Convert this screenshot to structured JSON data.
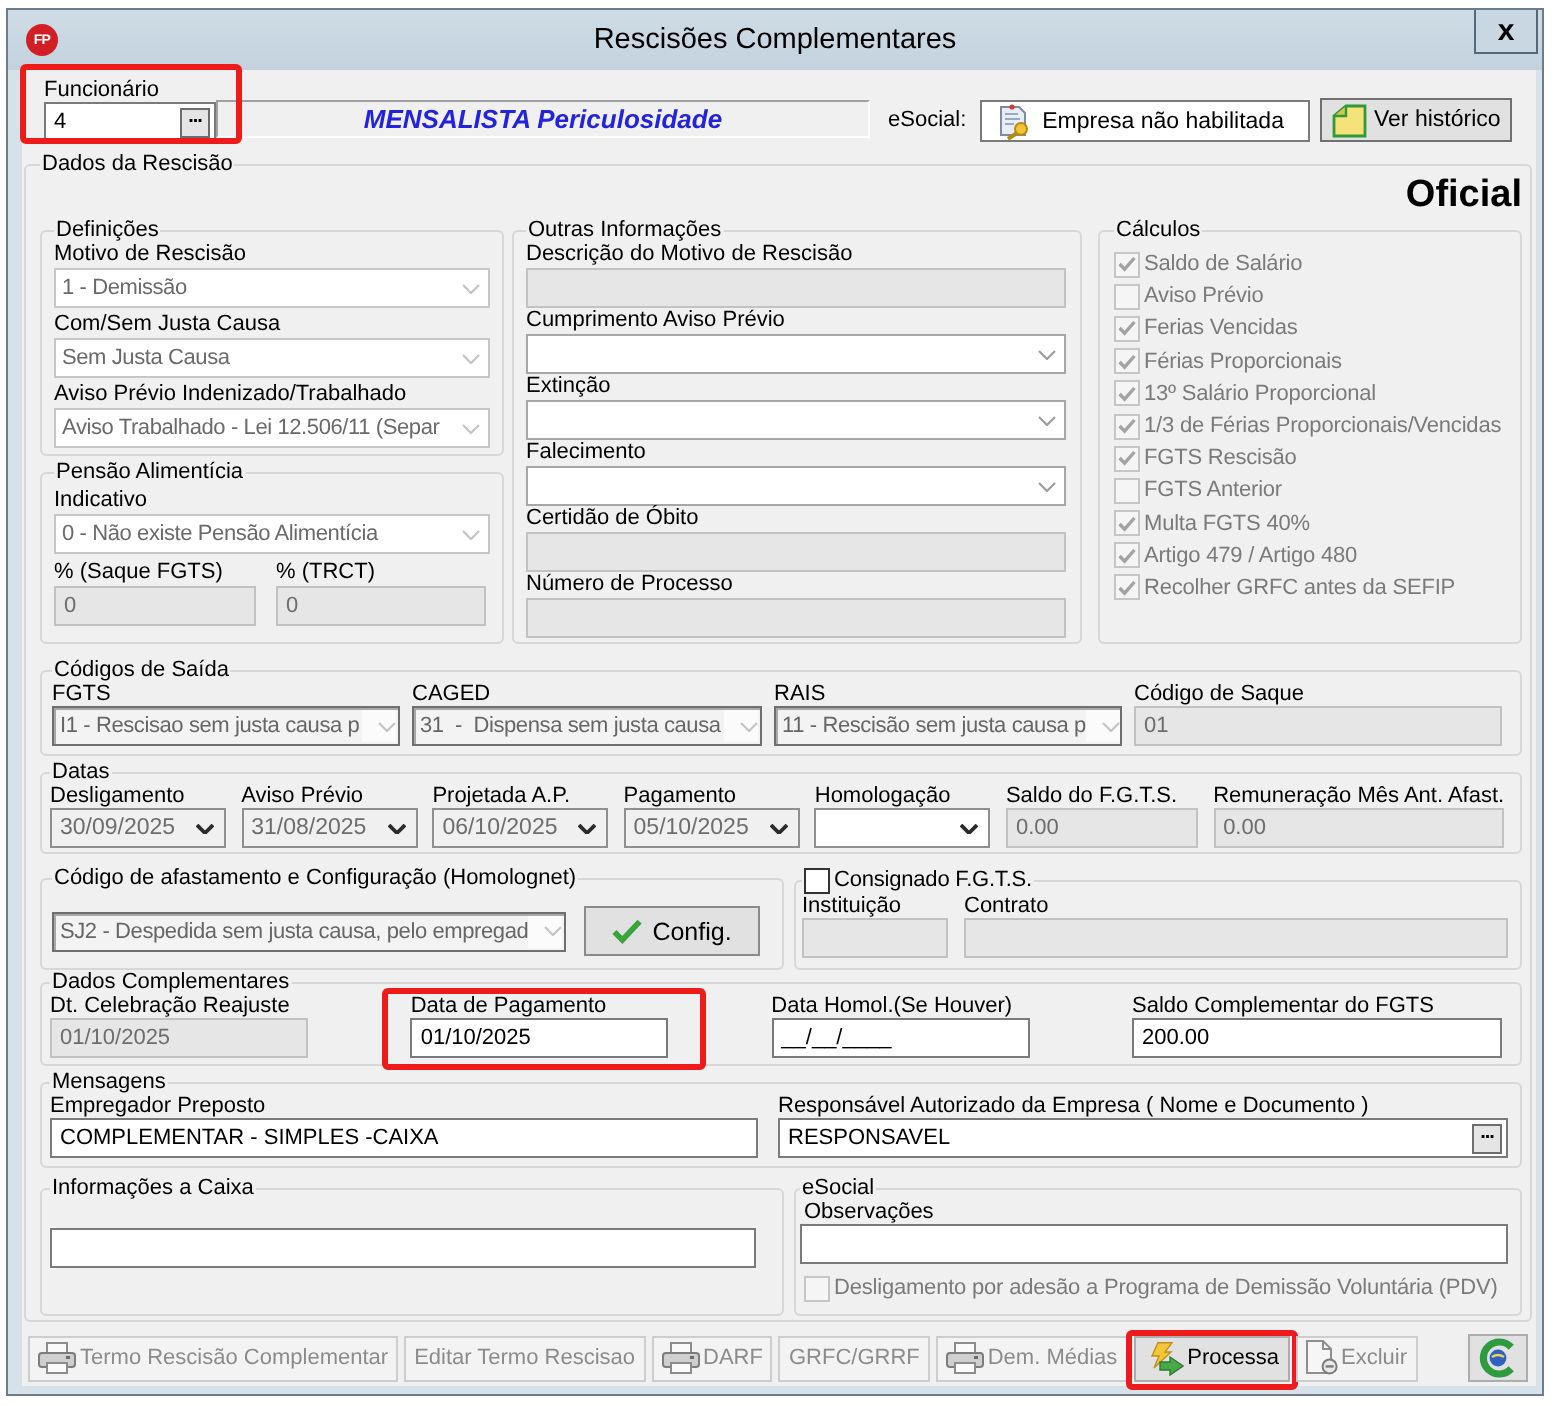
{
  "window": {
    "logo_text": "FP",
    "title": "Rescisões Complementares",
    "close_label": "x"
  },
  "header": {
    "employee": {
      "label": "Funcionário",
      "value": "4",
      "lookup_label": "...",
      "highlighted": true
    },
    "category": "MENSALISTA Periculosidade",
    "esocial_label": "eSocial:",
    "esocial_status": "Empresa não habilitada",
    "history_button": "Ver histórico"
  },
  "termination": {
    "title": "Dados da Rescisão",
    "mode": "Oficial",
    "definitions": {
      "title": "Definições",
      "fields": [
        {
          "kind": "combo",
          "label": "Motivo de Rescisão",
          "value": "1 - Demissão",
          "disabled": true
        },
        {
          "kind": "combo",
          "label": "Com/Sem Justa Causa",
          "value": "Sem Justa Causa",
          "disabled": true
        },
        {
          "kind": "combo",
          "label": "Aviso Prévio Indenizado/Trabalhado",
          "value": "Aviso Trabalhado - Lei 12.506/11 (Separ",
          "disabled": true
        }
      ]
    },
    "alimony": {
      "title": "Pensão Alimentícia",
      "indicator": {
        "kind": "combo",
        "label": "Indicativo",
        "value": "0 - Não existe Pensão Alimentícia",
        "disabled": true
      },
      "percentages": [
        {
          "kind": "input",
          "label": "% (Saque FGTS)",
          "value": "0",
          "disabled": true
        },
        {
          "kind": "input",
          "label": "% (TRCT)",
          "value": "0",
          "disabled": true
        }
      ]
    },
    "other_info": {
      "title": "Outras Informações",
      "fields": [
        {
          "kind": "input",
          "label": "Descrição do Motivo de Rescisão",
          "disabled": true
        },
        {
          "kind": "combo",
          "label": "Cumprimento Aviso Prévio",
          "disabled": false
        },
        {
          "kind": "combo",
          "label": "Extinção",
          "disabled": false
        },
        {
          "kind": "combo",
          "label": "Falecimento",
          "disabled": false
        },
        {
          "kind": "input",
          "label": "Certidão de Óbito",
          "disabled": true
        },
        {
          "kind": "input",
          "label": "Número de Processo",
          "disabled": true
        }
      ]
    },
    "calculations": {
      "title": "Cálculos",
      "items": [
        {
          "label": "Saldo de Salário",
          "checked": true,
          "disabled": true
        },
        {
          "label": "Aviso Prévio",
          "checked": false,
          "disabled": true
        },
        {
          "label": "Ferias Vencidas",
          "checked": true,
          "disabled": true
        },
        {
          "label": "Férias Proporcionais",
          "checked": true,
          "disabled": true
        },
        {
          "label": "13º Salário Proporcional",
          "checked": true,
          "disabled": true
        },
        {
          "label": "1/3 de Férias Proporcionais/Vencidas",
          "checked": true,
          "disabled": true
        },
        {
          "label": "FGTS Rescisão",
          "checked": true,
          "disabled": true
        },
        {
          "label": "FGTS Anterior",
          "checked": false,
          "disabled": true
        },
        {
          "label": "Multa FGTS 40%",
          "checked": true,
          "disabled": true
        },
        {
          "label": "Artigo 479 / Artigo 480",
          "checked": true,
          "disabled": true
        },
        {
          "label": "Recolher GRFC antes da SEFIP",
          "checked": true,
          "disabled": true
        }
      ]
    },
    "exit_codes": {
      "title": "Códigos de Saída",
      "fields": [
        {
          "kind": "lookup",
          "label": "FGTS",
          "value": "I1 - Rescisao sem justa causa p",
          "disabled": true
        },
        {
          "kind": "lookup",
          "label": "CAGED",
          "value": "31  -  Dispensa sem justa causa",
          "disabled": true
        },
        {
          "kind": "lookup",
          "label": "RAIS",
          "value": "11 - Rescisão sem justa causa p",
          "disabled": true
        },
        {
          "kind": "input",
          "label": "Código de Saque",
          "value": "01",
          "disabled": true
        }
      ]
    },
    "dates": {
      "title": "Datas",
      "fields": [
        {
          "kind": "date",
          "label": "Desligamento",
          "value": "30/09/2025",
          "disabled": true
        },
        {
          "kind": "date",
          "label": "Aviso Prévio",
          "value": "31/08/2025",
          "disabled": true
        },
        {
          "kind": "date",
          "label": "Projetada A.P.",
          "value": "06/10/2025",
          "disabled": true
        },
        {
          "kind": "date",
          "label": "Pagamento",
          "value": "05/10/2025",
          "disabled": true
        },
        {
          "kind": "date",
          "label": "Homologação",
          "disabled": false
        },
        {
          "kind": "input",
          "label": "Saldo do F.G.T.S.",
          "value": "0.00",
          "disabled": true
        },
        {
          "kind": "input",
          "label": "Remuneração Mês Ant. Afast.",
          "value": "0.00",
          "disabled": true
        }
      ]
    },
    "absence_code": {
      "title": "Código de afastamento e Configuração (Homolognet)",
      "field": {
        "kind": "lookup",
        "value": "SJ2 - Despedida sem justa causa, pelo empregad",
        "disabled": true
      },
      "config_button": "Config."
    },
    "payroll_loan": {
      "label": "Consignado F.G.T.S.",
      "checked": false,
      "disabled": false,
      "fields": [
        {
          "kind": "input",
          "label": "Instituição",
          "disabled": true
        },
        {
          "kind": "input",
          "label": "Contrato",
          "disabled": true
        }
      ]
    },
    "complementary": {
      "title": "Dados Complementares",
      "fields": [
        {
          "kind": "input",
          "label": "Dt. Celebração Reajuste",
          "value": "01/10/2025",
          "disabled": true,
          "highlighted": false
        },
        {
          "kind": "input",
          "label": "Data de Pagamento",
          "value": "01/10/2025",
          "disabled": false,
          "highlighted": true
        },
        {
          "kind": "input",
          "label": "Data Homol.(Se Houver)",
          "value": "__/__/____",
          "disabled": false,
          "highlighted": false
        },
        {
          "kind": "input",
          "label": "Saldo Complementar do FGTS",
          "value": "200.00",
          "disabled": false,
          "highlighted": false
        }
      ]
    },
    "messages": {
      "title": "Mensagens",
      "fields": [
        {
          "kind": "input",
          "label": "Empregador Preposto",
          "value": "COMPLEMENTAR - SIMPLES -CAIXA",
          "disabled": false
        },
        {
          "kind": "input",
          "label": "Responsável Autorizado da Empresa ( Nome e Documento )",
          "value": "RESPONSAVEL",
          "button_label": "...",
          "disabled": false
        }
      ]
    },
    "cashier_info": {
      "title": "Informações a Caixa",
      "field": {
        "kind": "input",
        "disabled": false
      }
    },
    "esocial": {
      "title": "eSocial",
      "field": {
        "kind": "input",
        "label": "Observações",
        "disabled": false
      },
      "pdv": {
        "label": "Desligamento por adesão a Programa de Demissão Voluntária (PDV)",
        "checked": false,
        "disabled": true
      }
    }
  },
  "buttons": [
    {
      "kind": "print",
      "label": "Termo Rescisão Complementar",
      "disabled": true,
      "highlighted": false
    },
    {
      "kind": "text",
      "label": "Editar Termo Rescisao",
      "disabled": true,
      "highlighted": false
    },
    {
      "kind": "print",
      "label": "DARF",
      "disabled": true,
      "highlighted": false
    },
    {
      "kind": "text",
      "label": "GRFC/GRRF",
      "disabled": true,
      "highlighted": false
    },
    {
      "kind": "print",
      "label": "Dem. Médias",
      "disabled": true,
      "highlighted": false
    },
    {
      "kind": "process",
      "label": "Processa",
      "disabled": false,
      "highlighted": true
    },
    {
      "kind": "delete",
      "label": "Excluir",
      "disabled": true,
      "highlighted": false
    },
    {
      "kind": "logo",
      "disabled": false,
      "highlighted": false
    }
  ]
}
